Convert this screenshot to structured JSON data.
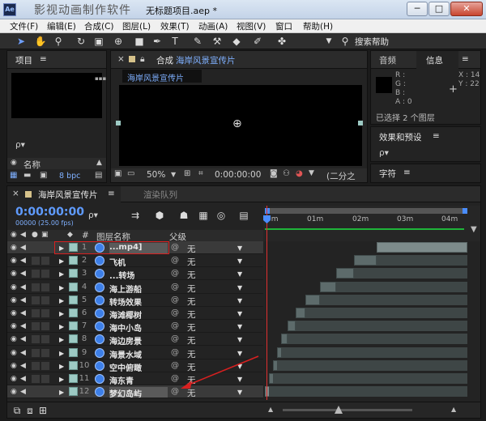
{
  "window": {
    "watermark": "影视动画制作软件",
    "title": "无标题项目.aep *",
    "minimize": "─",
    "maximize": "□",
    "close": "✕"
  },
  "menu": [
    "文件(F)",
    "编辑(E)",
    "合成(C)",
    "图层(L)",
    "效果(T)",
    "动画(A)",
    "视图(V)",
    "窗口",
    "帮助(H)"
  ],
  "toolbar": {
    "search_help": "搜索帮助"
  },
  "project_panel": {
    "tab": "项目",
    "search_placeholder": "ρ▾",
    "col_name": "名称",
    "bpc": "8 bpc"
  },
  "comp_panel": {
    "tab_prefix": "合成",
    "tab_name": "海岸风景宣传片",
    "sub_tab": "海岸风景宣传片",
    "zoom": "50%",
    "timecode": "0:00:00:00",
    "resolution": "(二分之"
  },
  "info_panel": {
    "tab_audio": "音频",
    "tab_info": "信息",
    "r": "R :",
    "g": "G :",
    "b": "B :",
    "a": "A : 0",
    "x": "X : 14",
    "y": "Y : 22",
    "selected": "已选择 2 个图层"
  },
  "effects_panel": {
    "tab": "效果和预设",
    "search": "ρ▾"
  },
  "char_panel": {
    "tab": "字符"
  },
  "timeline": {
    "tab_comp": "海岸风景宣传片",
    "tab_render": "渲染队列",
    "timecode": "0:00:00:00",
    "fps": "00000 (25.00 fps)",
    "search": "ρ▾",
    "col_num": "#",
    "col_name": "图层名称",
    "col_parent": "父级",
    "ruler": [
      "0m",
      "01m",
      "02m",
      "03m",
      "04m"
    ],
    "layers": [
      {
        "num": "1",
        "name": "...mp4]",
        "parent": "无",
        "start": 0.55,
        "end": 1.0,
        "light": true
      },
      {
        "num": "2",
        "name": "飞机",
        "parent": "无",
        "start": 0.44,
        "end": 0.55,
        "light": false
      },
      {
        "num": "3",
        "name": "...转场",
        "parent": "无",
        "start": 0.35,
        "end": 0.44,
        "light": false
      },
      {
        "num": "4",
        "name": "海上游船",
        "parent": "无",
        "start": 0.27,
        "end": 0.35,
        "light": false
      },
      {
        "num": "5",
        "name": "转场效果",
        "parent": "无",
        "start": 0.2,
        "end": 0.27,
        "light": false
      },
      {
        "num": "6",
        "name": "海滩椰树",
        "parent": "无",
        "start": 0.15,
        "end": 0.2,
        "light": false
      },
      {
        "num": "7",
        "name": "海中小岛",
        "parent": "无",
        "start": 0.11,
        "end": 0.15,
        "light": false
      },
      {
        "num": "8",
        "name": "海边房景",
        "parent": "无",
        "start": 0.08,
        "end": 0.11,
        "light": false
      },
      {
        "num": "9",
        "name": "海景水域",
        "parent": "无",
        "start": 0.06,
        "end": 0.08,
        "light": false
      },
      {
        "num": "10",
        "name": "空中俯瞰",
        "parent": "无",
        "start": 0.04,
        "end": 0.06,
        "light": false
      },
      {
        "num": "11",
        "name": "海东青",
        "parent": "无",
        "start": 0.02,
        "end": 0.04,
        "light": false
      },
      {
        "num": "12",
        "name": "梦幻岛屿",
        "parent": "无",
        "start": 0.0,
        "end": 0.02,
        "light": true
      }
    ]
  }
}
